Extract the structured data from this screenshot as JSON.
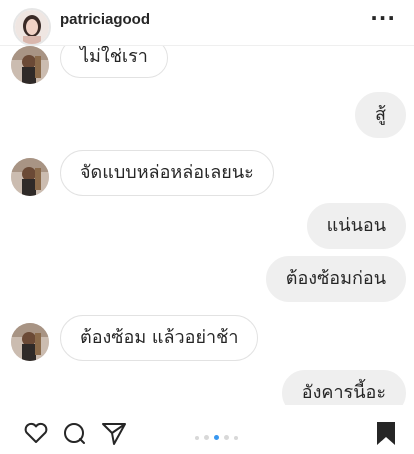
{
  "header": {
    "username": "patriciagood",
    "more_icon": "more-horizontal-icon"
  },
  "messages": [
    {
      "sender": "them",
      "text": "ไม่ใช่เรา"
    },
    {
      "sender": "me",
      "text": "สู้"
    },
    {
      "sender": "them",
      "text": "จัดแบบหล่อหล่อเลยนะ"
    },
    {
      "sender": "me",
      "text": "แน่นอน"
    },
    {
      "sender": "me",
      "text": "ต้องซ้อมก่อน"
    },
    {
      "sender": "them",
      "text": "ต้องซ้อม แล้วอย่าช้า"
    },
    {
      "sender": "me",
      "text": "อังคารนี้อะ"
    }
  ],
  "footer": {
    "icons": [
      "heart-icon",
      "comment-icon",
      "share-icon",
      "bookmark-icon"
    ],
    "carousel_index": 2,
    "carousel_count": 5
  },
  "colors": {
    "bubble_out": "#efefef",
    "bubble_border": "#e2e2e2",
    "accent": "#3897f0"
  }
}
